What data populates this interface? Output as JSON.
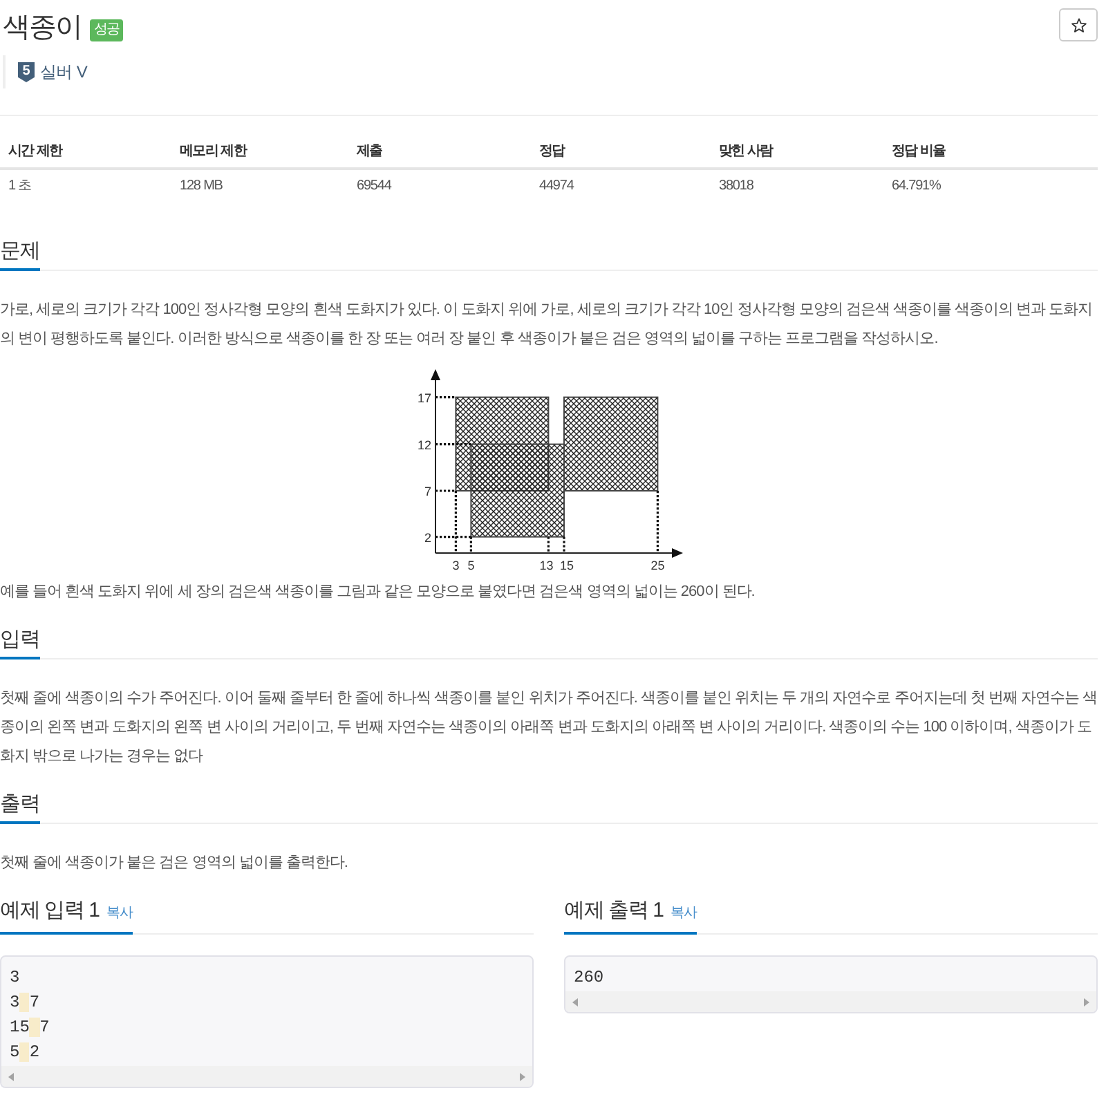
{
  "problem": {
    "title": "색종이",
    "status_badge": "성공"
  },
  "tier": {
    "number": "5",
    "label": "실버 V"
  },
  "stats_table": {
    "columns": [
      "시간 제한",
      "메모리 제한",
      "제출",
      "정답",
      "맞힌 사람",
      "정답 비율"
    ],
    "rows": [
      [
        "1 초",
        "128 MB",
        "69544",
        "44974",
        "38018",
        "64.791%"
      ]
    ]
  },
  "sections": [
    {
      "heading": "문제",
      "body": [
        {
          "kind": "text",
          "text": "가로, 세로의 크기가 각각 100인 정사각형 모양의 흰색 도화지가 있다. 이 도화지 위에 가로, 세로의 크기가 각각 10인 정사각형 모양의 검은색 색종이를 색종이의 변과 도화지의 변이 평행하도록 붙인다. 이러한 방식으로 색종이를 한 장 또는 여러 장 붙인 후 색종이가 붙은 검은 영역의 넓이를 구하는 프로그램을 작성하시오."
        },
        {
          "kind": "figure",
          "y_ticks": [
            "17",
            "12",
            "7",
            "2"
          ],
          "x_ticks": [
            "3",
            "5",
            "13",
            "15",
            "25"
          ]
        },
        {
          "kind": "text",
          "text": "예를 들어 흰색 도화지 위에 세 장의 검은색 색종이를 그림과 같은 모양으로 붙였다면 검은색 영역의 넓이는 260이 된다."
        }
      ]
    },
    {
      "heading": "입력",
      "body": [
        {
          "kind": "text",
          "text": "첫째 줄에 색종이의 수가 주어진다. 이어 둘째 줄부터 한 줄에 하나씩 색종이를 붙인 위치가 주어진다. 색종이를 붙인 위치는 두 개의 자연수로 주어지는데 첫 번째 자연수는 색종이의 왼쪽 변과 도화지의 왼쪽 변 사이의 거리이고, 두 번째 자연수는 색종이의 아래쪽 변과 도화지의 아래쪽 변 사이의 거리이다. 색종이의 수는 100 이하이며, 색종이가 도화지 밖으로 나가는 경우는 없다"
        }
      ]
    },
    {
      "heading": "출력",
      "body": [
        {
          "kind": "text",
          "text": "첫째 줄에 색종이가 붙은 검은 영역의 넓이를 출력한다."
        }
      ]
    }
  ],
  "examples": [
    {
      "heading": "예제 입력 1",
      "copy_label": "복사",
      "lines": [
        "3",
        "3 7",
        "15 7",
        "5 2"
      ]
    },
    {
      "heading": "예제 출력 1",
      "copy_label": "복사",
      "lines": [
        "260"
      ]
    }
  ]
}
